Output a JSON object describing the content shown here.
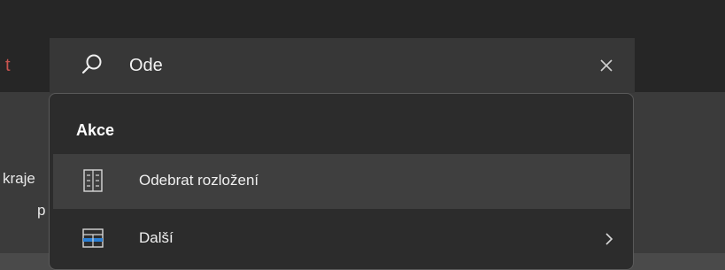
{
  "background": {
    "tab_fragment": "t",
    "label_1": "kraje",
    "label_2": "p"
  },
  "search": {
    "value": "Ode",
    "placeholder": ""
  },
  "dropdown": {
    "section_title": "Akce",
    "items": [
      {
        "label": "Odebrat rozložení",
        "icon": "remove-layout-icon",
        "highlighted": true
      },
      {
        "label": "Další",
        "icon": "layout-table-icon",
        "has_submenu": true
      }
    ]
  },
  "colors": {
    "titlebar": "#262626",
    "ribbon": "#3b3b3b",
    "searchbar": "#373737",
    "dropdown": "#2c2c2c",
    "highlight": "#3f3f3f",
    "accent_blue": "#2b7fd4",
    "tab_red": "#c9544f"
  }
}
